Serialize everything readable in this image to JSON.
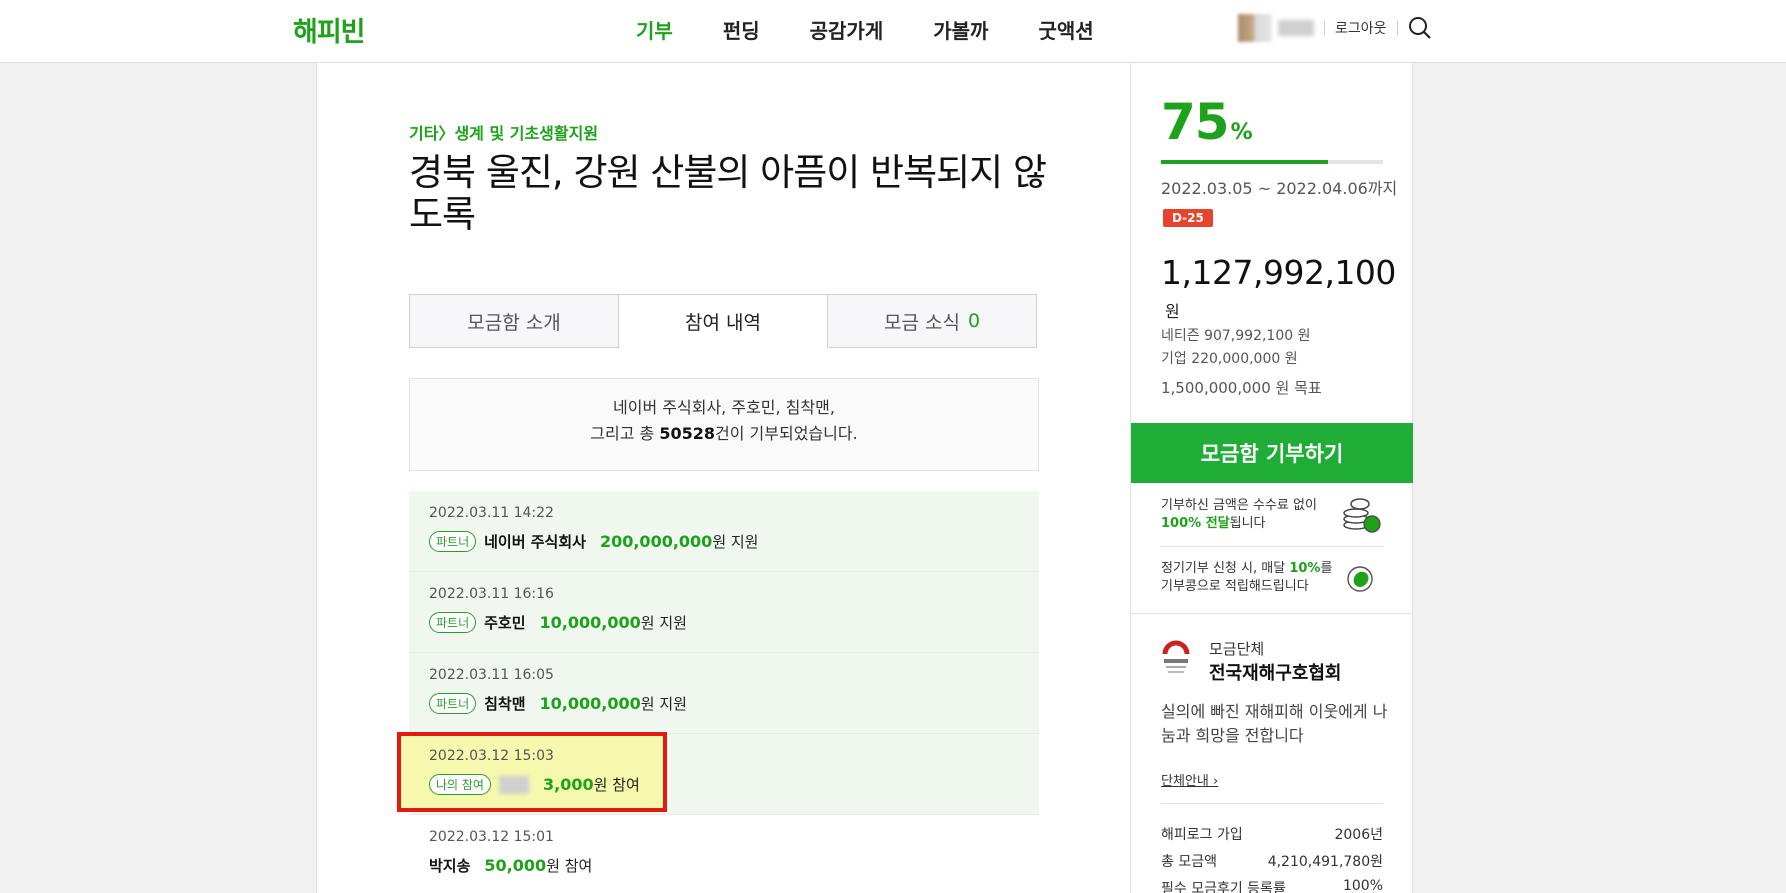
{
  "header": {
    "logo": "해피빈",
    "nav": [
      "기부",
      "펀딩",
      "공감가게",
      "가볼까",
      "굿액션"
    ],
    "logout": "로그아웃"
  },
  "campaign": {
    "breadcrumb": "기타〉생계 및 기초생활지원",
    "title": "경북 울진, 강원 산불의 아픔이 반복되지 않도록",
    "tabs": {
      "intro": "모금함 소개",
      "history": "참여 내역",
      "news": "모금 소식",
      "news_count": "0"
    },
    "summary": {
      "line1": "네이버 주식회사, 주호민, 침착맨,",
      "line2_pre": "그리고 총 ",
      "count": "50528",
      "line2_post": "건이 기부되었습니다."
    },
    "entries": [
      {
        "date": "2022.03.11 14:22",
        "badge": "파트너",
        "name": "네이버 주식회사",
        "amount": "200,000,000",
        "suffix": "원 지원"
      },
      {
        "date": "2022.03.11 16:16",
        "badge": "파트너",
        "name": "주호민",
        "amount": "10,000,000",
        "suffix": "원 지원"
      },
      {
        "date": "2022.03.11 16:05",
        "badge": "파트너",
        "name": "침착맨",
        "amount": "10,000,000",
        "suffix": "원 지원"
      },
      {
        "date": "2022.03.12 15:03",
        "badge": "나의 참여",
        "amount": "3,000",
        "suffix": "원 참여"
      },
      {
        "date": "2022.03.12 15:01",
        "name": "박지송",
        "amount": "50,000",
        "suffix": "원 참여"
      }
    ]
  },
  "sidebar": {
    "percent": "75",
    "percent_sign": "%",
    "progress": 0.75,
    "period": "2022.03.05 ~ 2022.04.06까지",
    "dday": "D-25",
    "total": "1,127,992,100",
    "total_unit": "원",
    "netizen": "네티즌 907,992,100 원",
    "company": "기업 220,000,000 원",
    "goal": "1,500,000,000 원 목표",
    "donate_button": "모금함 기부하기",
    "info1_a": "기부하신 금액은 수수료 없이",
    "info1_b_g": "100% 전달",
    "info1_b": "됩니다",
    "info2_a_pre": "정기기부 신청 시, 매달 ",
    "info2_a_g": "10%",
    "info2_a_post": "를",
    "info2_b": "기부콩으로 적립해드립니다",
    "org_sub": "모금단체",
    "org_name": "전국재해구호협회",
    "org_desc": "실의에 빠진 재해피해 이웃에게 나눔과 희망을 전합니다",
    "org_link": "단체안내 ›",
    "stats": [
      {
        "label": "해피로그 가입",
        "value": "2006년"
      },
      {
        "label": "총 모금액",
        "value": "4,210,491,780원"
      },
      {
        "label": "필수 모금후기 등록률",
        "value": "100%"
      }
    ],
    "colors": {
      "brand": "#1ea11b",
      "button": "#20ad37",
      "dday": "#e8432d",
      "highlight_border": "#e21b12"
    }
  }
}
